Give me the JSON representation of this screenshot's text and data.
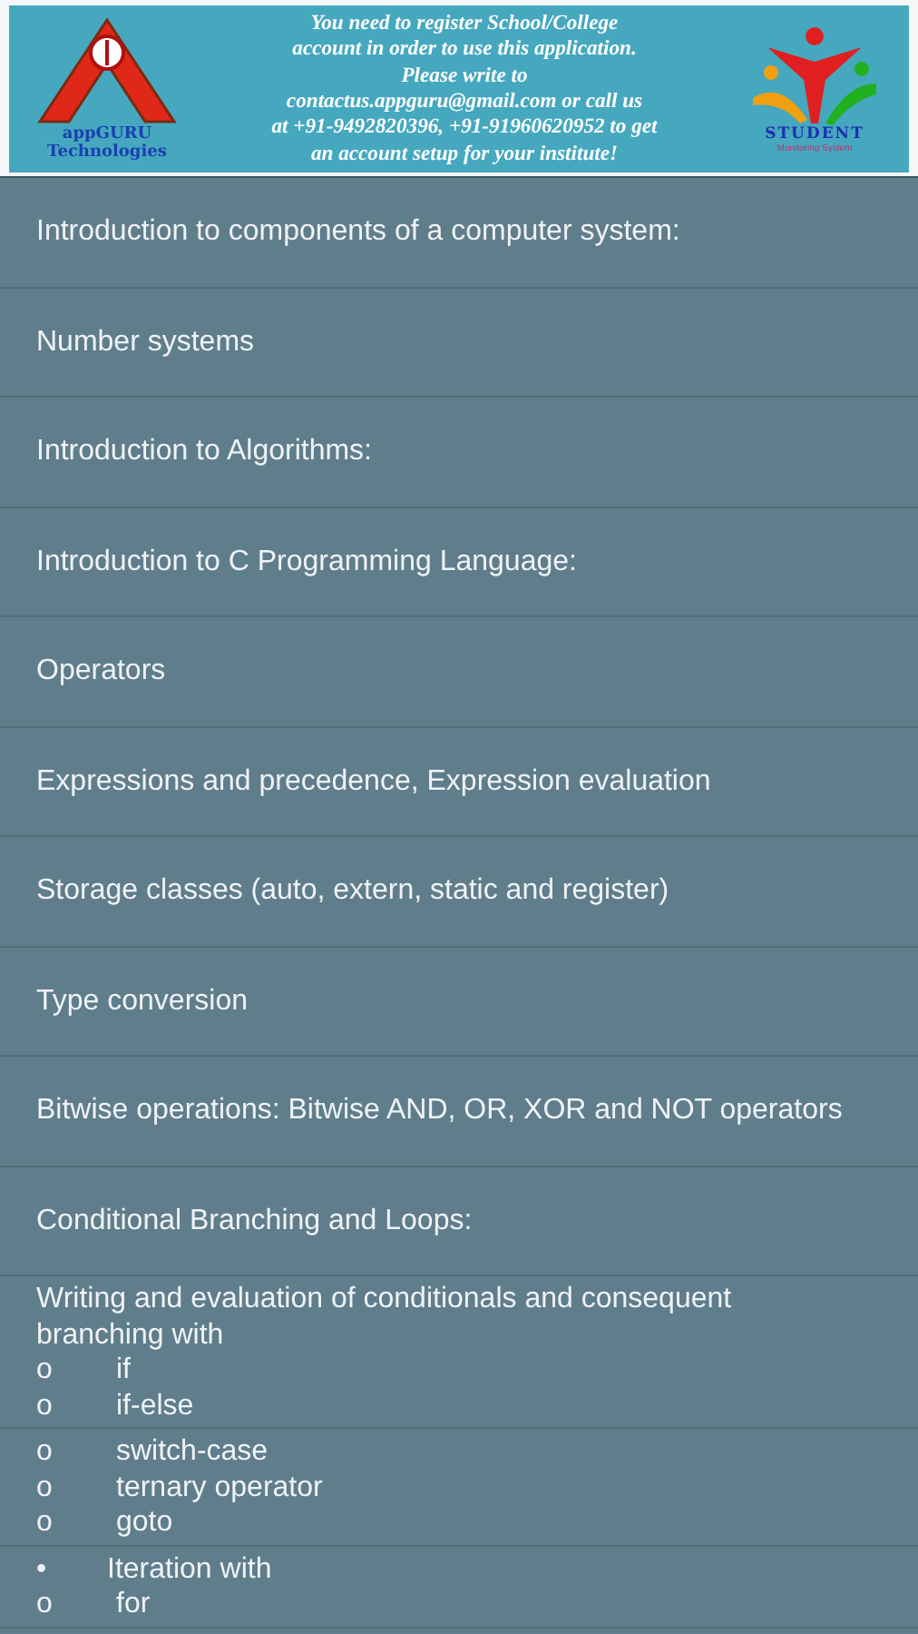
{
  "banner": {
    "left_logo": {
      "lines": [
        "appGURU",
        "Technologies"
      ]
    },
    "message": [
      "You need to register School/College",
      "account in order to use this application.",
      "Please write to",
      "contactus.appguru@gmail.com or call us",
      "at +91-9492820396, +91-91960620952 to get",
      "an account setup for your institute!"
    ],
    "right_logo": {
      "title": "STUDENT",
      "subtitle": "Monitoring System"
    }
  },
  "topics": [
    {
      "lines": [
        {
          "kind": "text",
          "text": "Introduction to components of a computer system:"
        }
      ]
    },
    {
      "lines": [
        {
          "kind": "text",
          "text": "Number systems"
        }
      ]
    },
    {
      "lines": [
        {
          "kind": "text",
          "text": "Introduction to Algorithms:"
        }
      ]
    },
    {
      "lines": [
        {
          "kind": "text",
          "text": "Introduction to C Programming Language:"
        }
      ]
    },
    {
      "lines": [
        {
          "kind": "text",
          "text": "Operators"
        }
      ]
    },
    {
      "lines": [
        {
          "kind": "text",
          "text": "Expressions and precedence, Expression evaluation"
        }
      ]
    },
    {
      "lines": [
        {
          "kind": "text",
          "text": "Storage classes (auto, extern, static and register)"
        }
      ]
    },
    {
      "lines": [
        {
          "kind": "text",
          "text": "Type conversion"
        }
      ]
    },
    {
      "lines": [
        {
          "kind": "text",
          "text": "Bitwise operations: Bitwise AND, OR, XOR and NOT operators"
        }
      ]
    },
    {
      "lines": [
        {
          "kind": "text",
          "text": "Conditional Branching and Loops:"
        }
      ]
    },
    {
      "lines": [
        {
          "kind": "text",
          "text": "Writing and evaluation of conditionals and consequent branching with"
        },
        {
          "kind": "bullet",
          "marker": "o",
          "text": "if"
        },
        {
          "kind": "bullet",
          "marker": "o",
          "text": "if-else"
        }
      ]
    },
    {
      "lines": [
        {
          "kind": "bullet",
          "marker": "o",
          "text": "switch-case"
        },
        {
          "kind": "bullet",
          "marker": "o",
          "text": "ternary operator"
        },
        {
          "kind": "bullet",
          "marker": "o",
          "text": "goto"
        }
      ]
    },
    {
      "lines": [
        {
          "kind": "bullet",
          "marker": "•",
          "text": "Iteration with"
        },
        {
          "kind": "bullet",
          "marker": "o",
          "text": "for"
        }
      ]
    }
  ]
}
